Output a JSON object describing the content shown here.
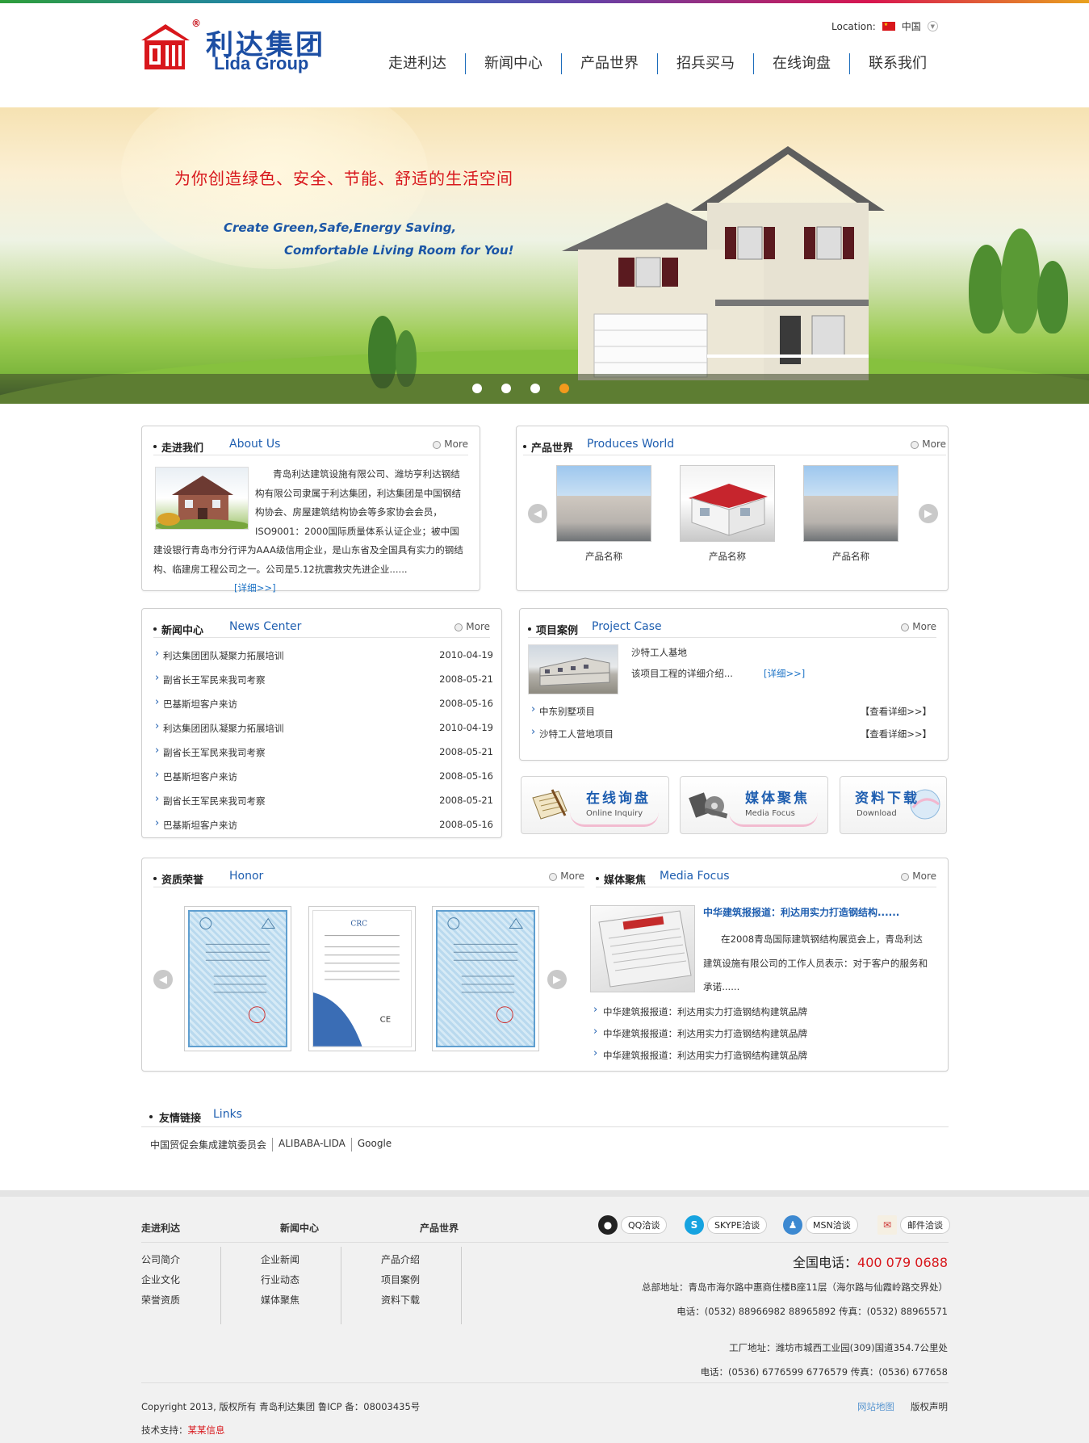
{
  "header": {
    "logo_cn": "利达集团",
    "logo_en": "Lida Group",
    "logo_reg": "®",
    "location_label": "Location:",
    "location_value": "中国",
    "nav": [
      "走进利达",
      "新闻中心",
      "产品世界",
      "招兵买马",
      "在线询盘",
      "联系我们"
    ]
  },
  "banner": {
    "slogan_cn": "为你创造绿色、安全、节能、舒适的生活空间",
    "slogan_en_1": "Create Green,Safe,Energy Saving,",
    "slogan_en_2": "Comfortable Living Room for You!",
    "slide_count": 4,
    "active_slide": 4
  },
  "more": "More",
  "about": {
    "title_cn": "走进我们",
    "title_en": "About Us",
    "text": "青岛利达建筑设施有限公司、潍坊亨利达钢结构有限公司隶属于利达集团，利达集团是中国钢结构协会、房屋建筑结构协会等多家协会会员，ISO9001：2000国际质量体系认证企业；被中国建设银行青岛市分行评为AAA级信用企业，是山东省及全国具有实力的钢结构、临建房工程公司之一。公司是5.12抗震救灾先进企业......",
    "detail": "[详细>>]"
  },
  "products": {
    "title_cn": "产品世界",
    "title_en": "Produces World",
    "items": [
      "产品名称",
      "产品名称",
      "产品名称"
    ]
  },
  "news": {
    "title_cn": "新闻中心",
    "title_en": "News Center",
    "rows": [
      {
        "title": "利达集团团队凝聚力拓展培训",
        "date": "2010-04-19"
      },
      {
        "title": "副省长王军民来我司考察",
        "date": "2008-05-21"
      },
      {
        "title": "巴基斯坦客户来访",
        "date": "2008-05-16"
      },
      {
        "title": "利达集团团队凝聚力拓展培训",
        "date": "2010-04-19"
      },
      {
        "title": "副省长王军民来我司考察",
        "date": "2008-05-21"
      },
      {
        "title": "巴基斯坦客户来访",
        "date": "2008-05-16"
      },
      {
        "title": "副省长王军民来我司考察",
        "date": "2008-05-21"
      },
      {
        "title": "巴基斯坦客户来访",
        "date": "2008-05-16"
      }
    ]
  },
  "cases": {
    "title_cn": "项目案例",
    "title_en": "Project Case",
    "feature_title": "沙特工人基地",
    "feature_desc": "该项目工程的详细介绍...",
    "feature_detail": "[详细>>]",
    "rows": [
      {
        "title": "中东别墅项目",
        "link": "【查看详细>>】"
      },
      {
        "title": "沙特工人营地项目",
        "link": "【查看详细>>】"
      }
    ]
  },
  "quick": [
    {
      "cn": "在线询盘",
      "en": "Online Inquiry"
    },
    {
      "cn": "媒体聚焦",
      "en": "Media Focus"
    },
    {
      "cn": "资料下载",
      "en": "Download"
    }
  ],
  "honor": {
    "title_cn": "资质荣誉",
    "title_en": "Honor"
  },
  "media": {
    "title_cn": "媒体聚焦",
    "title_en": "Media Focus",
    "headline": "中华建筑报报道：利达用实力打造钢结构......",
    "text": "在2008青岛国际建筑钢结构展览会上，青岛利达建筑设施有限公司的工作人员表示：对于客户的服务和承诺......",
    "rows": [
      "中华建筑报报道：利达用实力打造钢结构建筑品牌",
      "中华建筑报报道：利达用实力打造钢结构建筑品牌",
      "中华建筑报报道：利达用实力打造钢结构建筑品牌"
    ]
  },
  "links": {
    "title_cn": "友情链接",
    "title_en": "Links",
    "items": [
      "中国贸促会集成建筑委员会",
      "ALIBABA-LIDA",
      "Google"
    ]
  },
  "footer": {
    "cols": [
      {
        "title": "走进利达",
        "items": [
          "公司简介",
          "企业文化",
          "荣誉资质"
        ]
      },
      {
        "title": "新闻中心",
        "items": [
          "企业新闻",
          "行业动态",
          "媒体聚焦"
        ]
      },
      {
        "title": "产品世界",
        "items": [
          "产品介绍",
          "项目案例",
          "资料下载"
        ]
      }
    ],
    "chat": [
      "QQ洽谈",
      "SKYPE洽谈",
      "MSN洽谈",
      "邮件洽谈"
    ],
    "phone_label": "全国电话：",
    "phone": "400 079 0688",
    "hq_address": "总部地址：青岛市海尔路中惠商住楼B座11层（海尔路与仙霞岭路交界处）",
    "hq_tel": "电话：(0532) 88966982   88965892 传真：(0532) 88965571",
    "factory_address": "工厂地址：潍坊市城西工业园(309)国道354.7公里处",
    "factory_tel": "电话：(0536) 6776599 6776579 传真：(0536) 677658",
    "copyright": "Copyright 2013, 版权所有 青岛利达集团 鲁ICP 备：08003435号",
    "tech_label": "技术支持：",
    "tech_value": "某某信息",
    "sitemap": "网站地图",
    "rights": "版权声明"
  }
}
